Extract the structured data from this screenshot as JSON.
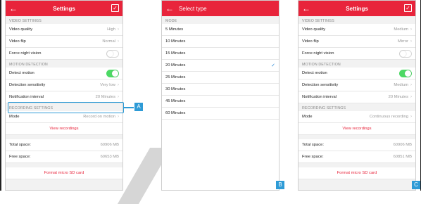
{
  "screen_a": {
    "title": "Settings",
    "sections": {
      "video": "VIDEO SETTINGS",
      "motion": "MOTION DETECTION",
      "recording": "RECORDING SETTINGS"
    },
    "rows": {
      "video_quality": {
        "label": "Video quality",
        "value": "High"
      },
      "video_flip": {
        "label": "Video flip",
        "value": "Normal"
      },
      "force_night": {
        "label": "Force night vision",
        "on": false
      },
      "detect_motion": {
        "label": "Detect motion",
        "on": true
      },
      "sensitivity": {
        "label": "Detection sensitivity",
        "value": "Very low"
      },
      "interval": {
        "label": "Notification interval",
        "value": "20 Minutes"
      },
      "mode": {
        "label": "Mode",
        "value": "Record on motion"
      }
    },
    "view_recordings": "View recordings",
    "total_space": {
      "label": "Total space:",
      "value": "60906 MB"
    },
    "free_space": {
      "label": "Free space:",
      "value": "60653 MB"
    },
    "format": "Format micro SD card"
  },
  "screen_b": {
    "title": "Select type",
    "section": "MODE",
    "options": [
      "5 Minutes",
      "10 Minutes",
      "15 Minutes",
      "20 Minutes",
      "25 Minutes",
      "30 Minutes",
      "45 Minutes",
      "60 Minutes"
    ],
    "selected": "20 Minutes"
  },
  "screen_c": {
    "title": "Settings",
    "sections": {
      "video": "VIDEO SETTINGS",
      "motion": "MOTION DETECTION",
      "recording": "RECORDING SETTINGS"
    },
    "rows": {
      "video_quality": {
        "label": "Video quality",
        "value": "Medium"
      },
      "video_flip": {
        "label": "Video flip",
        "value": "Mirror"
      },
      "force_night": {
        "label": "Force night vision",
        "on": false
      },
      "detect_motion": {
        "label": "Detect motion",
        "on": true
      },
      "sensitivity": {
        "label": "Detection sensitivity",
        "value": "Medium"
      },
      "interval": {
        "label": "Notification interval",
        "value": "20 Minutes"
      },
      "mode": {
        "label": "Mode",
        "value": "Continuous recording"
      }
    },
    "view_recordings": "View recordings",
    "total_space": {
      "label": "Total space:",
      "value": "60906 MB"
    },
    "free_space": {
      "label": "Free space:",
      "value": "60851 MB"
    },
    "format": "Format micro SD card"
  },
  "tags": {
    "a": "A",
    "b": "B",
    "c": "C"
  },
  "colors": {
    "accent": "#e8243b",
    "callout": "#2e9bd6",
    "toggle_on": "#4cd964"
  }
}
